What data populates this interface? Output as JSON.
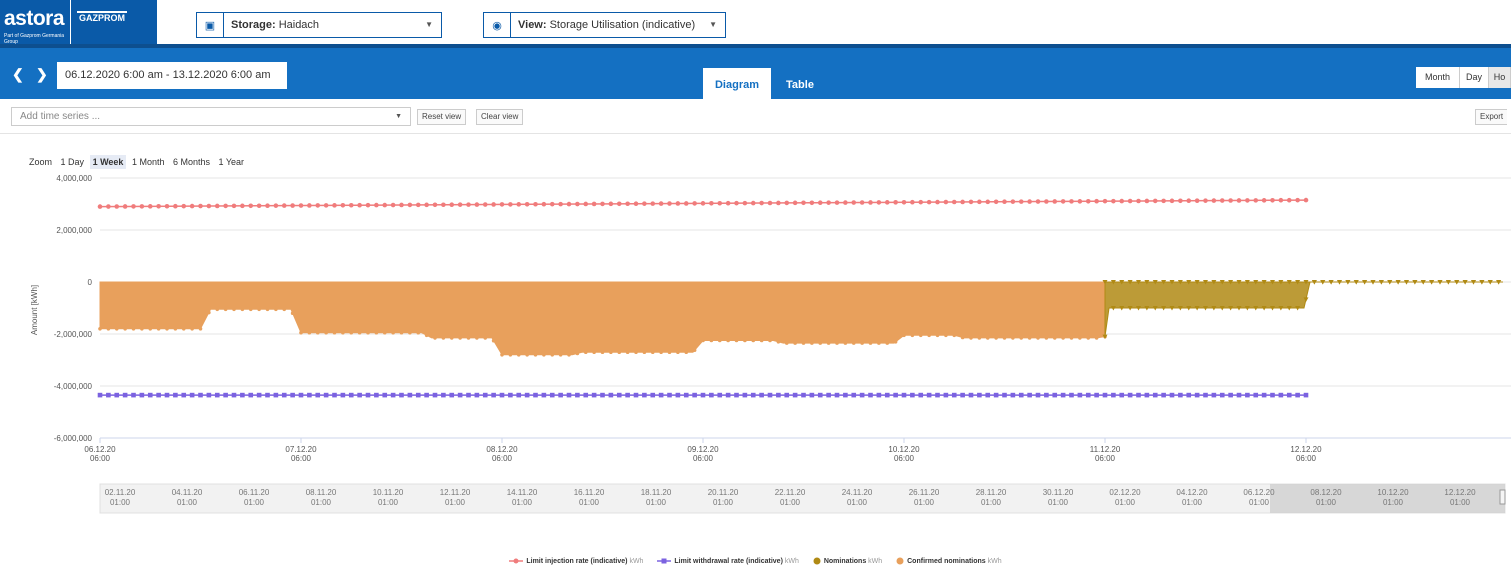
{
  "header": {
    "logo_text": "astora",
    "logo_subtext": "Part of Gazprom Germania Group",
    "partner_logo_text": "GAZPROM",
    "storage_label": "Storage:",
    "storage_value": "Haidach",
    "view_label": "View:",
    "view_value": "Storage Utilisation (indicative)"
  },
  "nav": {
    "prev_icon": "chevron-left-icon",
    "next_icon": "chevron-right-icon",
    "date_range": "06.12.2020 6:00 am - 13.12.2020 6:00 am",
    "tabs": [
      {
        "label": "Diagram"
      },
      {
        "label": "Table"
      }
    ],
    "period_buttons": [
      "Month",
      "Day",
      "Ho"
    ]
  },
  "toolbar": {
    "add_series_placeholder": "Add time series ...",
    "reset_label": "Reset view",
    "clear_label": "Clear view",
    "export_label": "Export"
  },
  "zoom": {
    "label": "Zoom",
    "options": [
      "1 Day",
      "1 Week",
      "1 Month",
      "6 Months",
      "1 Year"
    ],
    "active": "1 Week"
  },
  "colors": {
    "primary": "#1470c2",
    "injection": "#f07c7c",
    "withdrawal": "#7b62e0",
    "nominations": "#b08a14",
    "confirmed": "#e8a05c"
  },
  "chart_data": {
    "type": "area",
    "ylabel": "Amount [kWh]",
    "ylim": [
      -6000000,
      4000000
    ],
    "y_ticks": [
      "4,000,000",
      "2,000,000",
      "0",
      "-2,000,000",
      "-4,000,000",
      "-6,000,000"
    ],
    "x_ticks": [
      {
        "date": "06.12.20",
        "time": "06:00"
      },
      {
        "date": "07.12.20",
        "time": "06:00"
      },
      {
        "date": "08.12.20",
        "time": "06:00"
      },
      {
        "date": "09.12.20",
        "time": "06:00"
      },
      {
        "date": "10.12.20",
        "time": "06:00"
      },
      {
        "date": "11.12.20",
        "time": "06:00"
      },
      {
        "date": "12.12.20",
        "time": "06:00"
      }
    ],
    "navigator_ticks": [
      {
        "date": "02.11.20",
        "time": "01:00"
      },
      {
        "date": "04.11.20",
        "time": "01:00"
      },
      {
        "date": "06.11.20",
        "time": "01:00"
      },
      {
        "date": "08.11.20",
        "time": "01:00"
      },
      {
        "date": "10.11.20",
        "time": "01:00"
      },
      {
        "date": "12.11.20",
        "time": "01:00"
      },
      {
        "date": "14.11.20",
        "time": "01:00"
      },
      {
        "date": "16.11.20",
        "time": "01:00"
      },
      {
        "date": "18.11.20",
        "time": "01:00"
      },
      {
        "date": "20.11.20",
        "time": "01:00"
      },
      {
        "date": "22.11.20",
        "time": "01:00"
      },
      {
        "date": "24.11.20",
        "time": "01:00"
      },
      {
        "date": "26.11.20",
        "time": "01:00"
      },
      {
        "date": "28.11.20",
        "time": "01:00"
      },
      {
        "date": "30.11.20",
        "time": "01:00"
      },
      {
        "date": "02.12.20",
        "time": "01:00"
      },
      {
        "date": "04.12.20",
        "time": "01:00"
      },
      {
        "date": "06.12.20",
        "time": "01:00"
      },
      {
        "date": "08.12.20",
        "time": "01:00"
      },
      {
        "date": "10.12.20",
        "time": "01:00"
      },
      {
        "date": "12.12.20",
        "time": "01:00"
      }
    ],
    "series": [
      {
        "name": "Limit injection rate (indicative)",
        "unit": "kWh",
        "type": "line",
        "marker": "circle",
        "points": [
          [
            0,
            2900000
          ],
          [
            6,
            3150000
          ]
        ]
      },
      {
        "name": "Limit withdrawal rate (indicative)",
        "unit": "kWh",
        "type": "line",
        "marker": "square",
        "points": [
          [
            0,
            -4350000
          ],
          [
            6,
            -4350000
          ]
        ]
      },
      {
        "name": "Nominations",
        "unit": "kWh",
        "type": "area",
        "marker": "triangle",
        "points": [
          [
            5,
            -2100000
          ],
          [
            5.02,
            -1000000
          ],
          [
            5.99,
            -1000000
          ],
          [
            6.02,
            0
          ],
          [
            6.98,
            0
          ]
        ]
      },
      {
        "name": "Confirmed nominations",
        "unit": "kWh",
        "type": "area",
        "marker": "circle",
        "points": [
          [
            0,
            -1800000
          ],
          [
            0.5,
            -1800000
          ],
          [
            0.55,
            -1050000
          ],
          [
            0.95,
            -1050000
          ],
          [
            1.0,
            -1950000
          ],
          [
            1.6,
            -1950000
          ],
          [
            1.65,
            -2150000
          ],
          [
            1.95,
            -2150000
          ],
          [
            2.0,
            -2800000
          ],
          [
            2.35,
            -2800000
          ],
          [
            2.4,
            -2700000
          ],
          [
            2.95,
            -2700000
          ],
          [
            3.0,
            -2250000
          ],
          [
            3.35,
            -2250000
          ],
          [
            3.4,
            -2350000
          ],
          [
            3.95,
            -2350000
          ],
          [
            4.0,
            -2050000
          ],
          [
            4.25,
            -2050000
          ],
          [
            4.3,
            -2150000
          ],
          [
            4.96,
            -2150000
          ],
          [
            5.0,
            -2100000
          ]
        ]
      }
    ]
  }
}
